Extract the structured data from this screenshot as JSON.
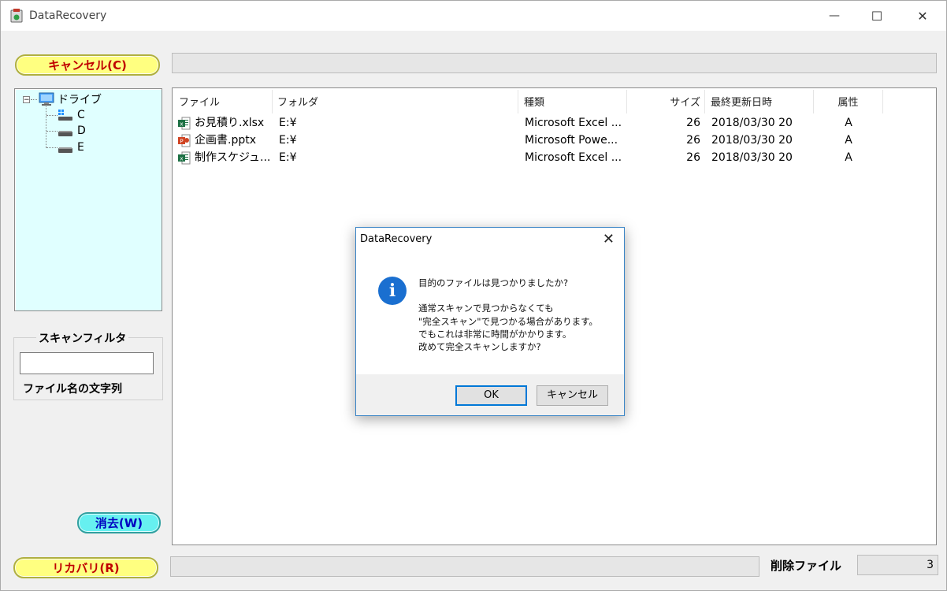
{
  "window": {
    "title": "DataRecovery",
    "controls": {
      "minimize": "—",
      "maximize": "☐",
      "close": "✕"
    }
  },
  "toolbar": {
    "cancel_label": "キャンセル(C)"
  },
  "tree": {
    "root_label": "ドライブ",
    "drives": [
      "C",
      "D",
      "E"
    ]
  },
  "filter": {
    "title": "スキャンフィルタ",
    "value": "",
    "caption": "ファイル名の文字列"
  },
  "buttons": {
    "clear_label": "消去(W)",
    "recover_label": "リカバリ(R)"
  },
  "list": {
    "columns": [
      "ファイル",
      "フォルダ",
      "種類",
      "サイズ",
      "最終更新日時",
      "属性"
    ],
    "rows": [
      {
        "icon": "excel-file-icon",
        "name": "お見積り.xlsx",
        "folder": "E:¥",
        "type": "Microsoft Excel ...",
        "size": "26",
        "modified": "2018/03/30 20",
        "attr": "A"
      },
      {
        "icon": "powerpoint-file-icon",
        "name": "企画書.pptx",
        "folder": "E:¥",
        "type": "Microsoft Powe...",
        "size": "26",
        "modified": "2018/03/30 20",
        "attr": "A"
      },
      {
        "icon": "excel-file-icon",
        "name": "制作スケジュ...",
        "folder": "E:¥",
        "type": "Microsoft Excel ...",
        "size": "26",
        "modified": "2018/03/30 20",
        "attr": "A"
      }
    ]
  },
  "status": {
    "deleted_label": "削除ファイル",
    "deleted_count": "3"
  },
  "dialog": {
    "title": "DataRecovery",
    "close": "✕",
    "lines": [
      "目的のファイルは見つかりましたか?",
      "通常スキャンで見つからなくても",
      "\"完全スキャン\"で見つかる場合があります。",
      "でもこれは非常に時間がかかります。",
      "改めて完全スキャンしますか?"
    ],
    "ok_label": "OK",
    "cancel_label": "キャンセル"
  },
  "colors": {
    "excel": "#1d7044",
    "powerpoint": "#d04423",
    "info": "#1a6fd0",
    "accent": "#0078d7"
  }
}
